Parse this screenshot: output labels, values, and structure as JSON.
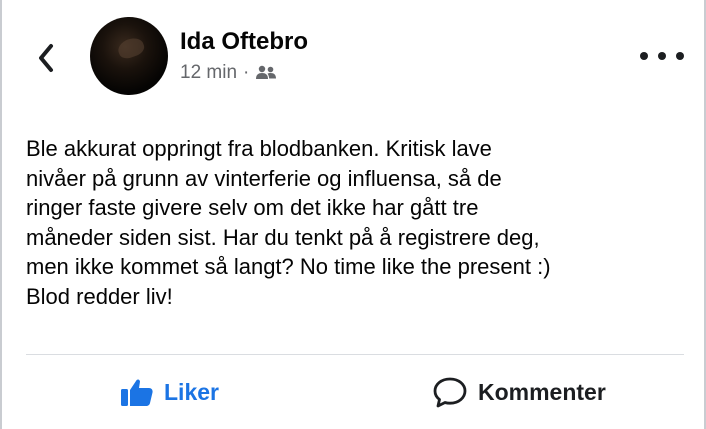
{
  "post": {
    "author": "Ida Oftebro",
    "time": "12 min",
    "separator": "·",
    "audience_icon": "friends-icon",
    "text": "Ble akkurat oppringt fra blodbanken. Kritisk lave\nnivåer på grunn av vinterferie og influensa, så de\nringer faste givere selv om det ikke har gått tre\nmåneder siden sist. Har du tenkt på å registrere deg,\nmen ikke kommet så langt? No time like the present :)\nBlod redder liv!"
  },
  "actions": {
    "like_label": "Liker",
    "comment_label": "Kommenter"
  },
  "colors": {
    "like_blue": "#1b74e4",
    "meta_gray": "#65676b"
  }
}
